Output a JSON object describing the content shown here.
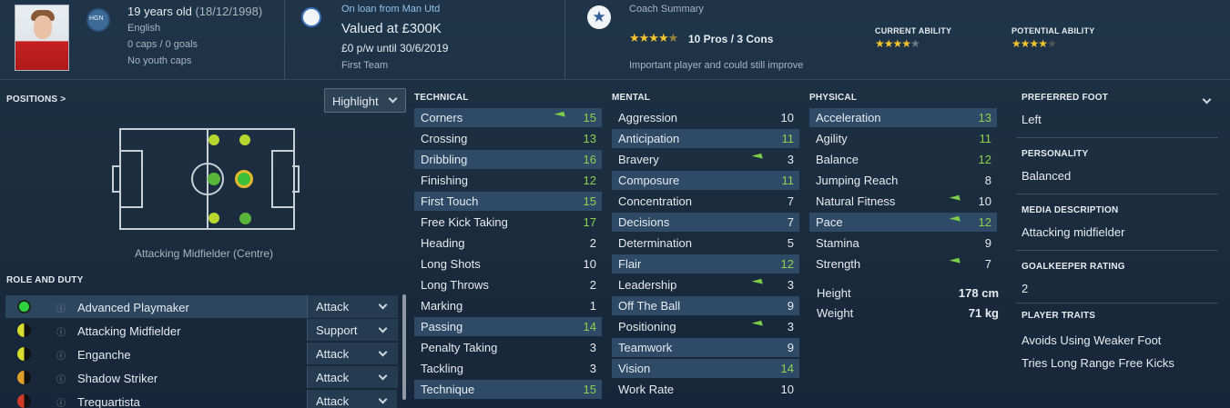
{
  "header": {
    "age": "19 years old",
    "dob": "(18/12/1998)",
    "nationality": "English",
    "nation_badge": "HGN",
    "caps": "0 caps / 0 goals",
    "youth": "No youth caps",
    "loan": "On loan from Man Utd",
    "value": "Valued at £300K",
    "wage": "£0 p/w until 30/6/2019",
    "squad": "First Team",
    "coach_title": "Coach Summary",
    "coach_pros": "10 Pros / 3 Cons",
    "coach_text": "Important player and could still improve",
    "current_ability_label": "CURRENT ABILITY",
    "potential_ability_label": "POTENTIAL ABILITY",
    "coach_stars": 4,
    "current_stars": 4,
    "potential_stars": 4.5
  },
  "positions": {
    "title": "POSITIONS >",
    "highlight_label": "Highlight",
    "position_name": "Attacking Midfielder (Centre)"
  },
  "roles": {
    "title": "ROLE AND DUTY",
    "items": [
      {
        "role": "Advanced Playmaker",
        "duty": "Attack"
      },
      {
        "role": "Attacking Midfielder",
        "duty": "Support"
      },
      {
        "role": "Enganche",
        "duty": "Attack"
      },
      {
        "role": "Shadow Striker",
        "duty": "Attack"
      },
      {
        "role": "Trequartista",
        "duty": "Attack"
      }
    ]
  },
  "technical": {
    "title": "TECHNICAL",
    "stats": [
      {
        "n": "Corners",
        "v": "15"
      },
      {
        "n": "Crossing",
        "v": "13"
      },
      {
        "n": "Dribbling",
        "v": "16"
      },
      {
        "n": "Finishing",
        "v": "12"
      },
      {
        "n": "First Touch",
        "v": "15"
      },
      {
        "n": "Free Kick Taking",
        "v": "17"
      },
      {
        "n": "Heading",
        "v": "2"
      },
      {
        "n": "Long Shots",
        "v": "10"
      },
      {
        "n": "Long Throws",
        "v": "2"
      },
      {
        "n": "Marking",
        "v": "1"
      },
      {
        "n": "Passing",
        "v": "14"
      },
      {
        "n": "Penalty Taking",
        "v": "3"
      },
      {
        "n": "Tackling",
        "v": "3"
      },
      {
        "n": "Technique",
        "v": "15"
      }
    ]
  },
  "mental": {
    "title": "MENTAL",
    "stats": [
      {
        "n": "Aggression",
        "v": "10"
      },
      {
        "n": "Anticipation",
        "v": "11"
      },
      {
        "n": "Bravery",
        "v": "3"
      },
      {
        "n": "Composure",
        "v": "11"
      },
      {
        "n": "Concentration",
        "v": "7"
      },
      {
        "n": "Decisions",
        "v": "7"
      },
      {
        "n": "Determination",
        "v": "5"
      },
      {
        "n": "Flair",
        "v": "12"
      },
      {
        "n": "Leadership",
        "v": "3"
      },
      {
        "n": "Off The Ball",
        "v": "9"
      },
      {
        "n": "Positioning",
        "v": "3"
      },
      {
        "n": "Teamwork",
        "v": "9"
      },
      {
        "n": "Vision",
        "v": "14"
      },
      {
        "n": "Work Rate",
        "v": "10"
      }
    ]
  },
  "physical": {
    "title": "PHYSICAL",
    "stats": [
      {
        "n": "Acceleration",
        "v": "13"
      },
      {
        "n": "Agility",
        "v": "11"
      },
      {
        "n": "Balance",
        "v": "12"
      },
      {
        "n": "Jumping Reach",
        "v": "8"
      },
      {
        "n": "Natural Fitness",
        "v": "10"
      },
      {
        "n": "Pace",
        "v": "12"
      },
      {
        "n": "Stamina",
        "v": "9"
      },
      {
        "n": "Strength",
        "v": "7"
      }
    ],
    "height_label": "Height",
    "height": "178 cm",
    "weight_label": "Weight",
    "weight": "71 kg"
  },
  "info": {
    "foot_label": "PREFERRED FOOT",
    "foot": "Left",
    "personality_label": "PERSONALITY",
    "personality": "Balanced",
    "media_label": "MEDIA DESCRIPTION",
    "media": "Attacking midfielder",
    "gk_label": "GOALKEEPER RATING",
    "gk": "2",
    "traits_label": "PLAYER TRAITS",
    "traits": [
      "Avoids Using Weaker Foot",
      "Tries Long Range Free Kicks"
    ]
  },
  "colors": {
    "green": "#8fd14f",
    "yellow": "#d8dc2a",
    "highlight": "#2e4a66"
  }
}
